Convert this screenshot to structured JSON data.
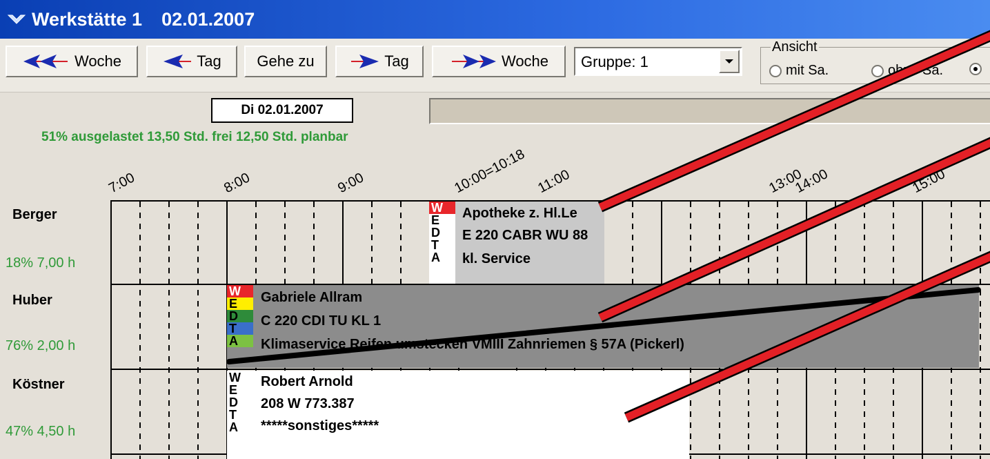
{
  "window": {
    "title_name": "Werkstätte 1",
    "title_date": "02.01.2007"
  },
  "toolbar": {
    "back_week": "Woche",
    "back_day": "Tag",
    "goto": "Gehe zu",
    "fwd_day": "Tag",
    "fwd_week": "Woche",
    "group_select": "Gruppe: 1",
    "view_legend": "Ansicht",
    "view_opt1": "mit Sa.",
    "view_opt2": "ohne Sa."
  },
  "day": {
    "date_label": "Di 02.01.2007",
    "utilization": "51% ausgelastet 13,50 Std. frei 12,50 Std. planbar"
  },
  "timeline": {
    "ticks": [
      "7:00",
      "8:00",
      "9:00",
      "10:00=10:18",
      "11:00",
      "13:00",
      "14:00",
      "15:00"
    ]
  },
  "rows": [
    {
      "name": "Berger",
      "load": "18%  7,00 h"
    },
    {
      "name": "Huber",
      "load": "76%  2,00 h"
    },
    {
      "name": "Köstner",
      "load": "47%  4,50 h"
    }
  ],
  "appointments": [
    {
      "line1": "Apotheke z. Hl.Le",
      "line2": "E 220 CABR WU 88",
      "line3": "kl. Service",
      "tags": [
        "W",
        "E",
        "D",
        "T",
        "A"
      ]
    },
    {
      "line1": "Gabriele Allram",
      "line2": "C 220 CDI TU KL 1",
      "line3": "Klimaservice Reifen umstecken VMIII Zahnriemen § 57A (Pickerl)",
      "tags": [
        "W",
        "E",
        "D",
        "T",
        "A"
      ]
    },
    {
      "line1": "Robert Arnold",
      "line2": "208 W 773.387",
      "line3": "*****sonstiges*****",
      "tags": [
        "W",
        "E",
        "D",
        "T",
        "A"
      ]
    }
  ],
  "colors": {
    "title_bar": "#0a3fb4",
    "green_text": "#2f9a38",
    "w_red": "#e8262b",
    "e_yellow": "#ffee00",
    "d_green": "#2e8b3a",
    "t_blue": "#3a6fc9",
    "a_green": "#7cc142",
    "overlay_red": "#e32026"
  }
}
